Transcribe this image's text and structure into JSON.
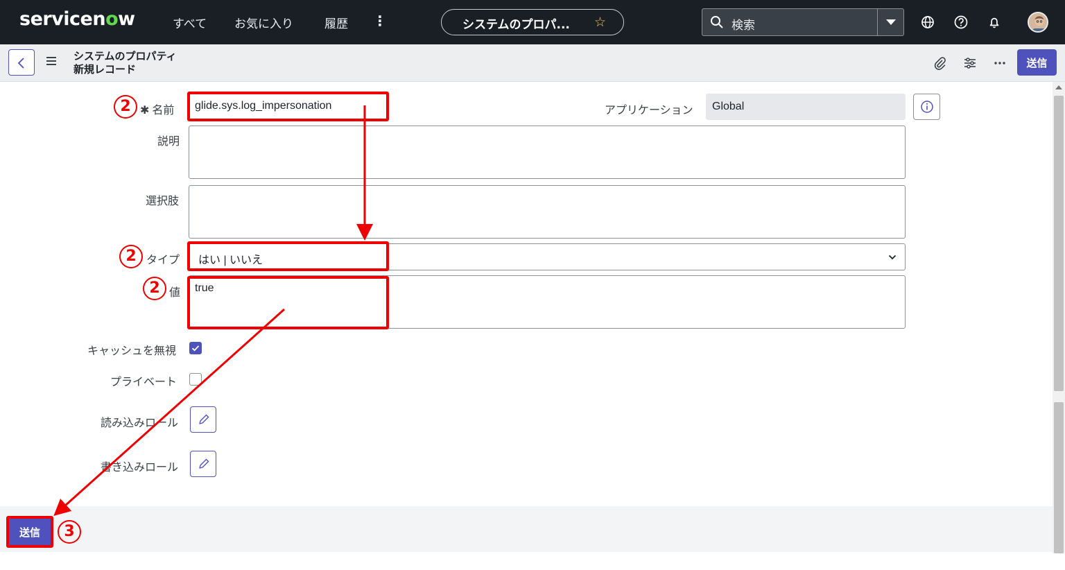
{
  "navbar": {
    "logo_prefix": "servicen",
    "logo_o": "o",
    "logo_suffix": "w",
    "items": [
      {
        "label": "すべて"
      },
      {
        "label": "お気に入り"
      },
      {
        "label": "履歴"
      }
    ],
    "more": "⋮",
    "context_label": "システムのプロパ...",
    "star": "☆",
    "search_placeholder": "検索"
  },
  "record_header": {
    "table_name": "システムのプロパティ",
    "record_state": "新規レコード",
    "submit_label": "送信"
  },
  "form": {
    "name": {
      "label": "名前",
      "required_mark": "✱",
      "value": "glide.sys.log_impersonation"
    },
    "application": {
      "label": "アプリケーション",
      "value": "Global"
    },
    "description": {
      "label": "説明",
      "value": ""
    },
    "choices": {
      "label": "選択肢",
      "value": ""
    },
    "type": {
      "label": "タイプ",
      "value": "はい | いいえ"
    },
    "value": {
      "label": "値",
      "value": "true"
    },
    "ignore_cache": {
      "label": "キャッシュを無視",
      "checked": true
    },
    "private": {
      "label": "プライベート",
      "checked": false
    },
    "read_roles": {
      "label": "読み込みロール"
    },
    "write_roles": {
      "label": "書き込みロール"
    }
  },
  "footer": {
    "submit_label": "送信"
  },
  "annotations": {
    "step_name": "2",
    "step_type": "2",
    "step_value": "2",
    "step_submit": "3",
    "color": "#ee0000"
  },
  "colors": {
    "navbar_bg": "#1a1f25",
    "primary": "#4f52bd",
    "logo_accent": "#62d84e"
  }
}
